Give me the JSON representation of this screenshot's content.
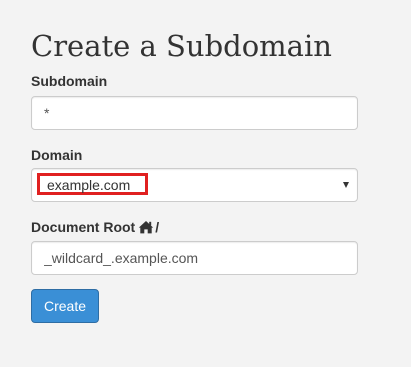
{
  "page": {
    "title": "Create a Subdomain"
  },
  "form": {
    "subdomain": {
      "label": "Subdomain",
      "value": "*"
    },
    "domain": {
      "label": "Domain",
      "selected": "example.com"
    },
    "document_root": {
      "label": "Document Root",
      "icon": "home-icon",
      "suffix": "/",
      "value": "_wildcard_.example.com"
    },
    "submit_label": "Create"
  },
  "colors": {
    "background": "#f3f3f3",
    "primary_button": "#3a8fd6",
    "highlight_box": "#e02020"
  }
}
